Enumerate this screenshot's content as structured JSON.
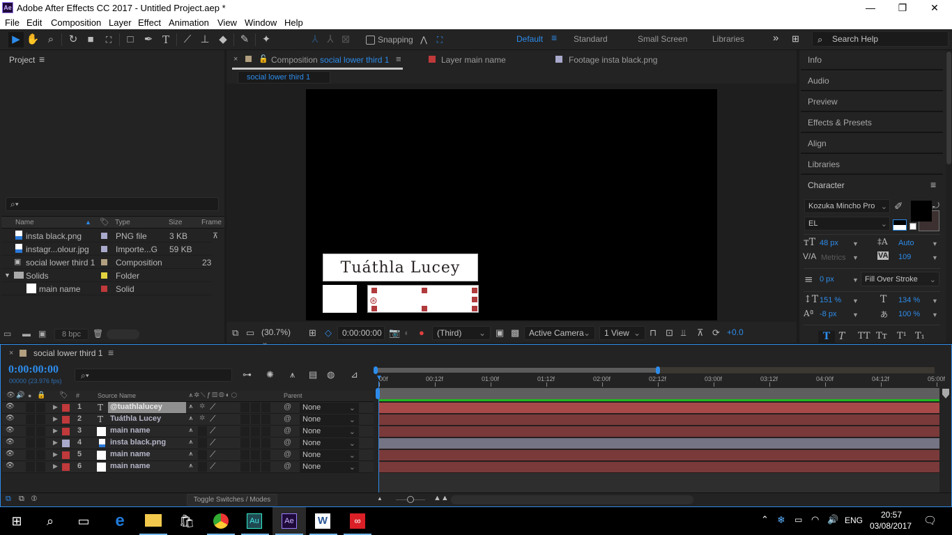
{
  "app": {
    "title": "Adobe After Effects CC 2017 - Untitled Project.aep *",
    "icon_label": "Ae",
    "window_controls": {
      "minimize": "—",
      "restore": "❐",
      "close": "✕"
    }
  },
  "menu": [
    "File",
    "Edit",
    "Composition",
    "Layer",
    "Effect",
    "Animation",
    "View",
    "Window",
    "Help"
  ],
  "toolbar": {
    "tools": [
      "selection-tool",
      "hand-tool",
      "zoom-tool",
      "rotation-tool",
      "camera-tool",
      "pan-behind-tool",
      "rectangle-tool",
      "pen-tool",
      "type-tool",
      "brush-tool",
      "clone-stamp-tool",
      "eraser-tool",
      "roto-brush-tool",
      "puppet-pin-tool"
    ],
    "snapping_label": "Snapping",
    "workspaces": [
      {
        "label": "Default",
        "active": true
      },
      {
        "label": "Standard",
        "active": false
      },
      {
        "label": "Small Screen",
        "active": false
      },
      {
        "label": "Libraries",
        "active": false
      }
    ],
    "more": "»",
    "search_placeholder": "Search Help"
  },
  "project": {
    "title": "Project",
    "columns": [
      "Name",
      "Type",
      "Size",
      "Frame"
    ],
    "bpc": "8 bpc",
    "items": [
      {
        "name": "insta black.png",
        "type": "PNG file",
        "size": "3 KB",
        "frame": "",
        "label_color": "#a9a9cc",
        "icon": "image-file-icon",
        "indent": 0
      },
      {
        "name": "instagr...olour.jpg",
        "type": "Importe...G",
        "size": "59 KB",
        "frame": "",
        "label_color": "#a9a9cc",
        "icon": "image-file-icon",
        "indent": 0
      },
      {
        "name": "social lower third 1",
        "type": "Composition",
        "size": "",
        "frame": "23",
        "label_color": "#b19f80",
        "icon": "composition-icon",
        "indent": 0
      },
      {
        "name": "Solids",
        "type": "Folder",
        "size": "",
        "frame": "",
        "label_color": "#e2d240",
        "icon": "folder-icon",
        "indent": 0,
        "expanded": true
      },
      {
        "name": "main name",
        "type": "Solid",
        "size": "",
        "frame": "",
        "label_color": "#c0393b",
        "icon": "solid-icon",
        "indent": 1
      }
    ]
  },
  "viewer": {
    "tabs": [
      {
        "prefix": "Composition",
        "name": "social lower third 1",
        "color": "#b19f80",
        "active": true
      },
      {
        "prefix": "Layer",
        "name": "main name",
        "color": "#c0393b",
        "active": false
      },
      {
        "prefix": "Footage",
        "name": "insta black.png",
        "color": "#a9a9cc",
        "active": false
      }
    ],
    "breadcrumb": "social lower third 1",
    "comp_text": "Tuáthla Lucey",
    "zoom": "(30.7%)",
    "timecode": "0:00:00:00",
    "resolution": "(Third)",
    "camera": "Active Camera",
    "views": "1 View",
    "exposure": "+0.0"
  },
  "right_panels": [
    "Info",
    "Audio",
    "Preview",
    "Effects & Presets",
    "Align",
    "Libraries"
  ],
  "character": {
    "title": "Character",
    "font": "Kozuka Mincho Pro",
    "style": "EL",
    "size": "48 px",
    "leading": "Auto",
    "kerning": "Metrics",
    "tracking": "109",
    "stroke_width": "0 px",
    "stroke_mode": "Fill Over Stroke",
    "vertical_scale": "151 %",
    "horizontal_scale": "134 %",
    "baseline_shift": "-8 px",
    "tsume": "100 %",
    "style_buttons": [
      "T",
      "T",
      "TT",
      "Tт",
      "T¹",
      "T₁"
    ]
  },
  "timeline": {
    "comp_name": "social lower third 1",
    "timecode": "0:00:00:00",
    "frame_info": "00000 (23.976 fps)",
    "columns": {
      "num": "#",
      "source": "Source Name",
      "parent": "Parent"
    },
    "ruler": [
      "00f",
      "00:12f",
      "01:00f",
      "01:12f",
      "02:00f",
      "02:12f",
      "03:00f",
      "03:12f",
      "04:00f",
      "04:12f",
      "05:00f"
    ],
    "work_area_end_fraction": 0.5,
    "layers": [
      {
        "num": "1",
        "name": "@tuathlalucey",
        "type": "text",
        "label_color": "#c0393b",
        "parent": "None",
        "selected": true,
        "bar_color": "#a84949"
      },
      {
        "num": "2",
        "name": "Tuáthla Lucey",
        "type": "text",
        "label_color": "#c0393b",
        "parent": "None",
        "selected": false,
        "bar_color": "#7a3a3a"
      },
      {
        "num": "3",
        "name": "main name",
        "type": "solid",
        "label_color": "#c0393b",
        "parent": "None",
        "selected": false,
        "bar_color": "#7a3a3a"
      },
      {
        "num": "4",
        "name": "insta black.png",
        "type": "footage",
        "label_color": "#a9a9cc",
        "parent": "None",
        "selected": false,
        "bar_color": "#747484"
      },
      {
        "num": "5",
        "name": "main name",
        "type": "solid",
        "label_color": "#c0393b",
        "parent": "None",
        "selected": false,
        "bar_color": "#7a3a3a"
      },
      {
        "num": "6",
        "name": "main name",
        "type": "solid",
        "label_color": "#c0393b",
        "parent": "None",
        "selected": false,
        "bar_color": "#7a3a3a"
      }
    ],
    "toggle_label": "Toggle Switches / Modes"
  },
  "taskbar": {
    "apps": [
      "start",
      "search",
      "task-view",
      "edge",
      "file-explorer",
      "store",
      "chrome",
      "audition",
      "after-effects",
      "word",
      "creative-cloud"
    ],
    "language": "ENG",
    "time": "20:57",
    "date": "03/08/2017"
  }
}
